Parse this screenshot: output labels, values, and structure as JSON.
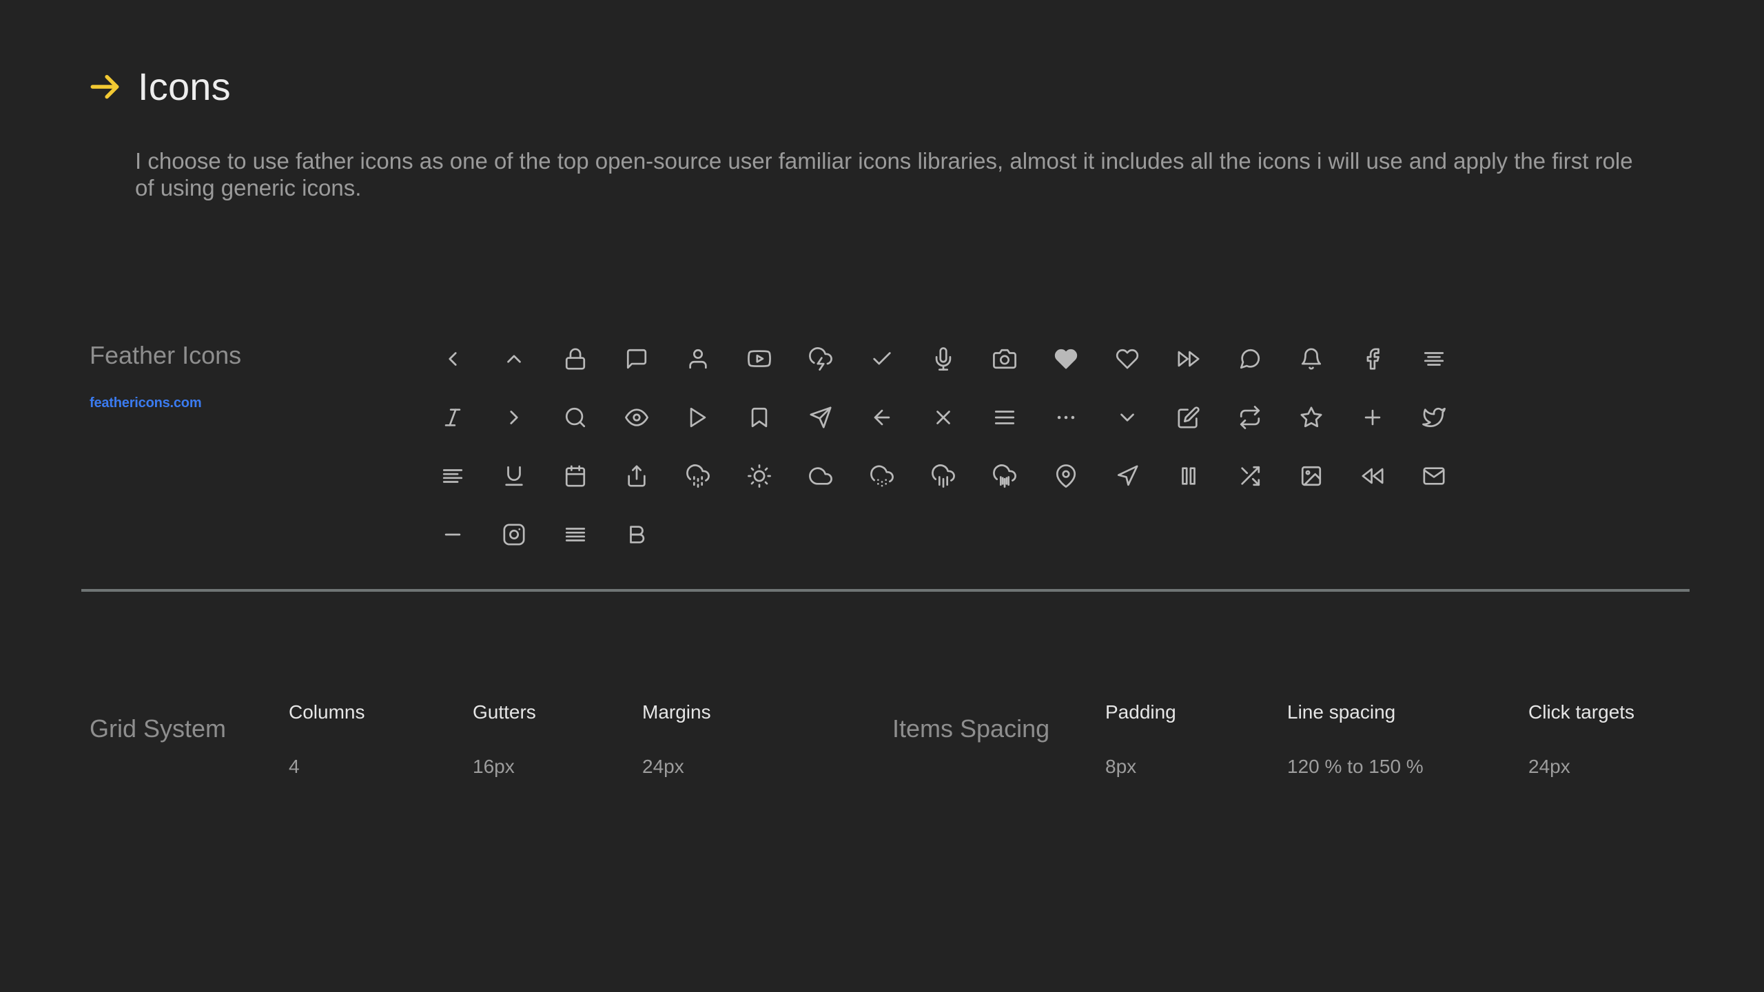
{
  "section": {
    "arrow_icon": "arrow-right-icon",
    "accent_color": "#F2C933",
    "title": "Icons",
    "description": "I choose to use father icons as one of the top open-source user familiar icons libraries, almost it includes all the icons i will use and apply the first role of using generic icons."
  },
  "feather": {
    "name": "Feather Icons",
    "link_label": "feathericons.com",
    "link_color": "#3b7bf0",
    "icons": [
      "chevron-left-icon",
      "chevron-up-icon",
      "lock-icon",
      "message-square-icon",
      "user-icon",
      "youtube-icon",
      "cloud-lightning-icon",
      "check-icon",
      "mic-icon",
      "camera-icon",
      "heart-filled-icon",
      "heart-icon",
      "fast-forward-icon",
      "message-circle-icon",
      "bell-icon",
      "facebook-icon",
      "align-center-icon",
      "italic-icon",
      "chevron-right-icon",
      "search-icon",
      "eye-icon",
      "play-icon",
      "bookmark-icon",
      "send-icon",
      "arrow-left-icon",
      "x-icon",
      "menu-icon",
      "more-horizontal-icon",
      "chevron-down-icon",
      "edit-icon",
      "repeat-icon",
      "star-icon",
      "plus-icon",
      "twitter-icon",
      "align-left-icon",
      "underline-icon",
      "calendar-icon",
      "share-icon",
      "cloud-drizzle-icon",
      "sun-icon",
      "cloud-icon",
      "cloud-snow-icon",
      "cloud-rain-icon",
      "cloud-rain-heavy-icon",
      "map-pin-icon",
      "navigation-icon",
      "pause-icon",
      "shuffle-icon",
      "image-icon",
      "rewind-icon",
      "mail-icon",
      "minus-icon",
      "instagram-icon",
      "align-justify-icon",
      "bold-icon"
    ]
  },
  "grid_system": {
    "heading_left": "Grid System",
    "heading_mid": "Items Spacing",
    "columns": [
      {
        "label": "Columns",
        "value": "4"
      },
      {
        "label": "Gutters",
        "value": "16px"
      },
      {
        "label": "Margins",
        "value": "24px"
      },
      {
        "label": "Padding",
        "value": "8px"
      },
      {
        "label": "Line spacing",
        "value": "120 % to 150 %"
      },
      {
        "label": "Click targets",
        "value": "24px"
      }
    ]
  }
}
